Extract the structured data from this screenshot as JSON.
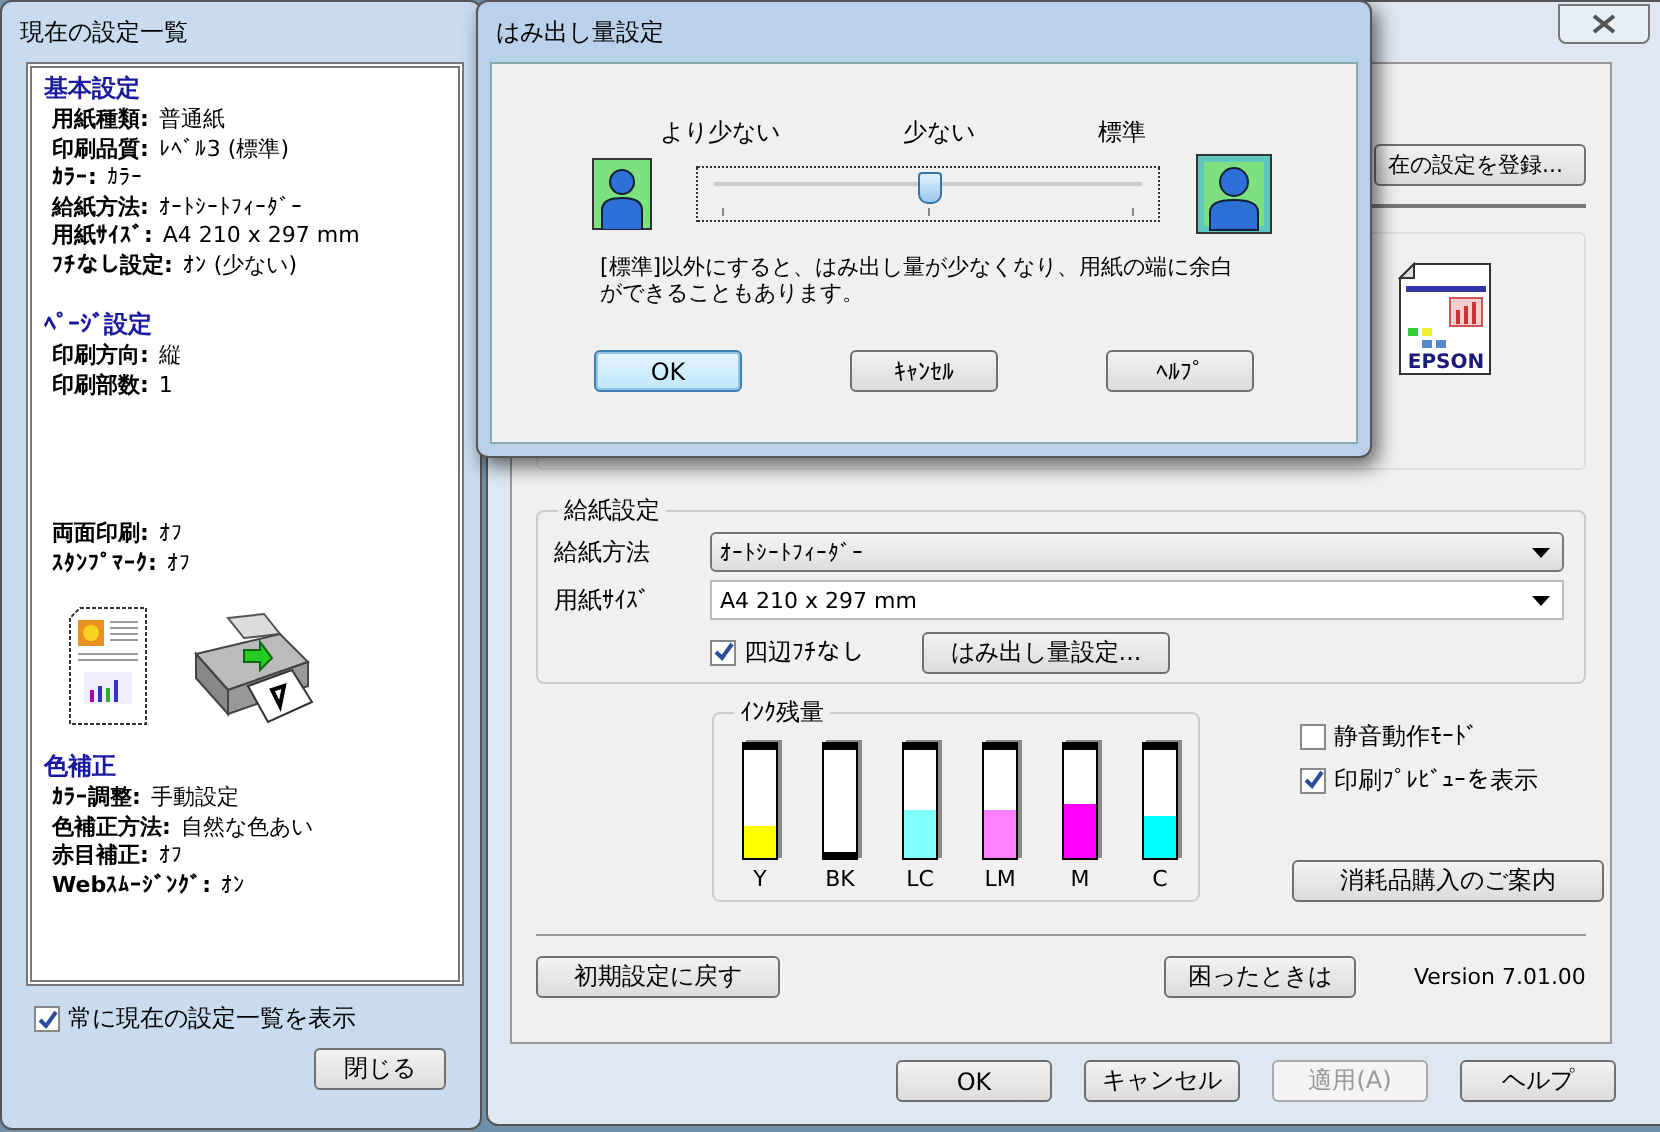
{
  "settings_panel": {
    "title": "現在の設定一覧",
    "sections": [
      {
        "kind": "settings",
        "heading": "基本設定",
        "items": [
          {
            "label": "用紙種類:",
            "value": "普通紙"
          },
          {
            "label": "印刷品質:",
            "value": "ﾚﾍﾞﾙ3 (標準)"
          },
          {
            "label": "ｶﾗｰ:",
            "value": "ｶﾗｰ"
          },
          {
            "label": "給紙方法:",
            "value": "ｵｰﾄｼｰﾄﾌｨｰﾀﾞｰ"
          },
          {
            "label": "用紙ｻｲｽﾞ:",
            "value": "A4 210 x 297 mm"
          },
          {
            "label": "ﾌﾁなし設定:",
            "value": "ｵﾝ (少ない)"
          }
        ]
      },
      {
        "kind": "settings",
        "heading": "ﾍﾟｰｼﾞ設定",
        "items": [
          {
            "label": "印刷方向:",
            "value": "縦"
          },
          {
            "label": "印刷部数:",
            "value": "1"
          }
        ]
      },
      {
        "kind": "settings",
        "items": [
          {
            "label": "両面印刷:",
            "value": "ｵﾌ"
          },
          {
            "label": "ｽﾀﾝﾌﾟﾏｰｸ:",
            "value": "ｵﾌ"
          }
        ]
      },
      {
        "kind": "preview"
      },
      {
        "kind": "settings",
        "heading": "色補正",
        "items": [
          {
            "label": "ｶﾗｰ調整:",
            "value": "手動設定"
          },
          {
            "label": "色補正方法:",
            "value": "自然な色あい"
          },
          {
            "label": "赤目補正:",
            "value": "ｵﾌ"
          },
          {
            "label": "Webｽﾑｰｼﾞﾝｸﾞ:",
            "value": "ｵﾝ"
          }
        ]
      }
    ],
    "always_show": {
      "label": "常に現在の設定一覧を表示",
      "checked": true
    },
    "close_button": "閉じる"
  },
  "main_window": {
    "register_button": "在の設定を登録...",
    "logo_text": "EPSON",
    "paper_group": {
      "title": "給紙設定",
      "source_label": "給紙方法",
      "source_value": "ｵｰﾄｼｰﾄﾌｨｰﾀﾞｰ",
      "size_label": "用紙ｻｲｽﾞ",
      "size_value": "A4 210 x 297 mm",
      "borderless": {
        "label": "四辺ﾌﾁなし",
        "checked": true
      },
      "expansion_button": "はみ出し量設定..."
    },
    "ink_group": {
      "title": "ｲﾝｸ残量",
      "inks": [
        {
          "name": "Y",
          "color": "#ffff00",
          "level": 0.3
        },
        {
          "name": "BK",
          "color": "#000000",
          "level": 0.05
        },
        {
          "name": "LC",
          "color": "#80ffff",
          "level": 0.45
        },
        {
          "name": "LM",
          "color": "#ff80ff",
          "level": 0.45
        },
        {
          "name": "M",
          "color": "#ff00ff",
          "level": 0.5
        },
        {
          "name": "C",
          "color": "#00ffff",
          "level": 0.38
        }
      ]
    },
    "options": [
      {
        "label": "静音動作ﾓｰﾄﾞ",
        "checked": false
      },
      {
        "label": "印刷ﾌﾟﾚﾋﾞｭｰを表示",
        "checked": true
      }
    ],
    "supplies_button": "消耗品購入のご案内",
    "reset_button": "初期設定に戻す",
    "trouble_button": "困ったときは",
    "version": "Version 7.01.00",
    "footer_buttons": [
      {
        "label": "OK",
        "disabled": false
      },
      {
        "label": "キャンセル",
        "disabled": false
      },
      {
        "label": "適用(A)",
        "disabled": true
      },
      {
        "label": "ヘルプ",
        "disabled": false
      }
    ]
  },
  "dialog": {
    "title": "はみ出し量設定",
    "slider_labels": [
      "より少ない",
      "少ない",
      "標準"
    ],
    "slider": {
      "level": 0.5
    },
    "note": "[標準]以外にすると、はみ出し量が少なくなり、用紙の端に余白ができることもあります。",
    "buttons": [
      {
        "label": "OK",
        "default": true
      },
      {
        "label": "ｷｬﾝｾﾙ",
        "default": false
      },
      {
        "label": "ﾍﾙﾌﾟ",
        "default": false
      }
    ]
  }
}
